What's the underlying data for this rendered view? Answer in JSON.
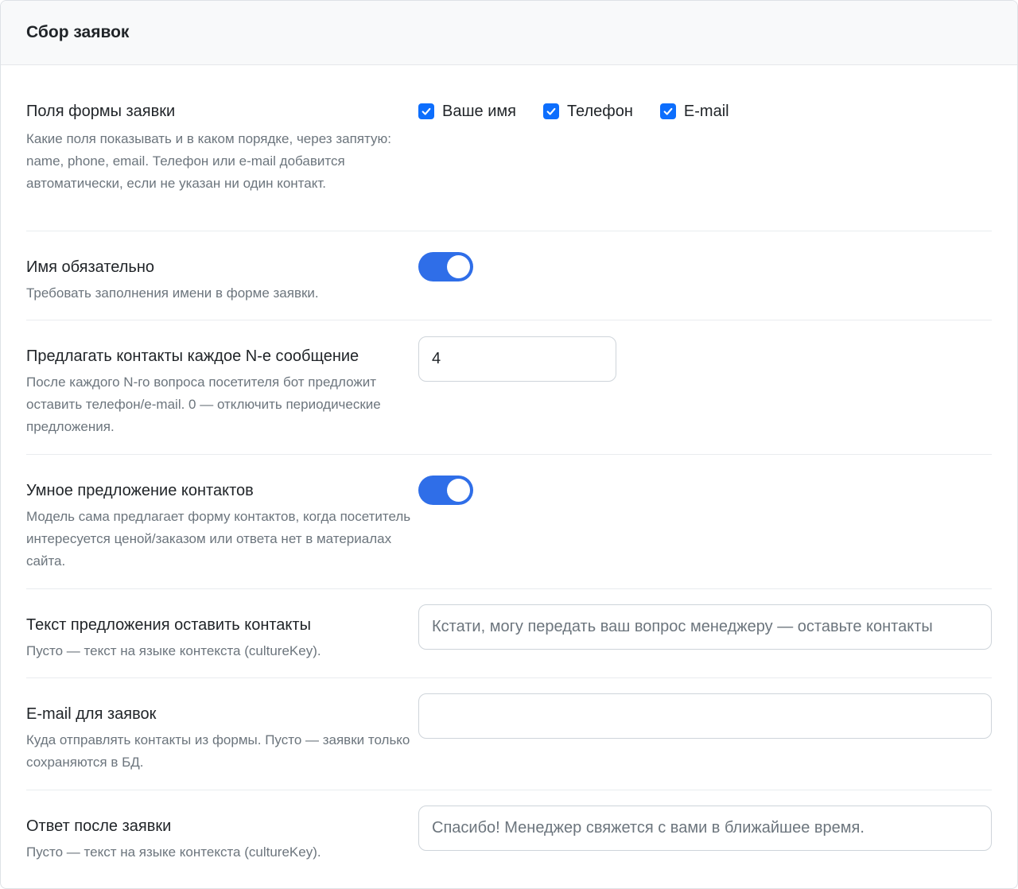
{
  "header": {
    "title": "Сбор заявок"
  },
  "fields": {
    "label": "Поля формы заявки",
    "help": "Какие поля показывать и в каком порядке, через запятую: name, phone, email. Телефон или e-mail добавится автоматически, если не указан ни один контакт.",
    "options": [
      {
        "label": "Ваше имя",
        "checked": true
      },
      {
        "label": "Телефон",
        "checked": true
      },
      {
        "label": "E-mail",
        "checked": true
      }
    ]
  },
  "name_required": {
    "label": "Имя обязательно",
    "help": "Требовать заполнения имени в форме заявки.",
    "enabled": true
  },
  "offer_every_n": {
    "label": "Предлагать контакты каждое N-е сообщение",
    "help": "После каждого N-го вопроса посетителя бот предложит оставить телефон/e-mail. 0 — отключить периодические предложения.",
    "value": "4"
  },
  "smart_offer": {
    "label": "Умное предложение контактов",
    "help": "Модель сама предлагает форму контактов, когда посетитель интересуется ценой/заказом или ответа нет в материалах сайта.",
    "enabled": true
  },
  "offer_text": {
    "label": "Текст предложения оставить контакты",
    "help": "Пусто — текст на языке контекста (cultureKey).",
    "value": "",
    "placeholder": "Кстати, могу передать ваш вопрос менеджеру — оставьте контакты"
  },
  "email": {
    "label": "E-mail для заявок",
    "help": "Куда отправлять контакты из формы. Пусто — заявки только сохраняются в БД.",
    "value": "",
    "placeholder": ""
  },
  "reply": {
    "label": "Ответ после заявки",
    "help": "Пусто — текст на языке контекста (cultureKey).",
    "value": "",
    "placeholder": "Спасибо! Менеджер свяжется с вами в ближайшее время."
  },
  "colors": {
    "accent": "#2f6ee8",
    "checkbox": "#0d6efd",
    "help_text": "#6c757d",
    "header_bg": "#f8f9fa"
  }
}
